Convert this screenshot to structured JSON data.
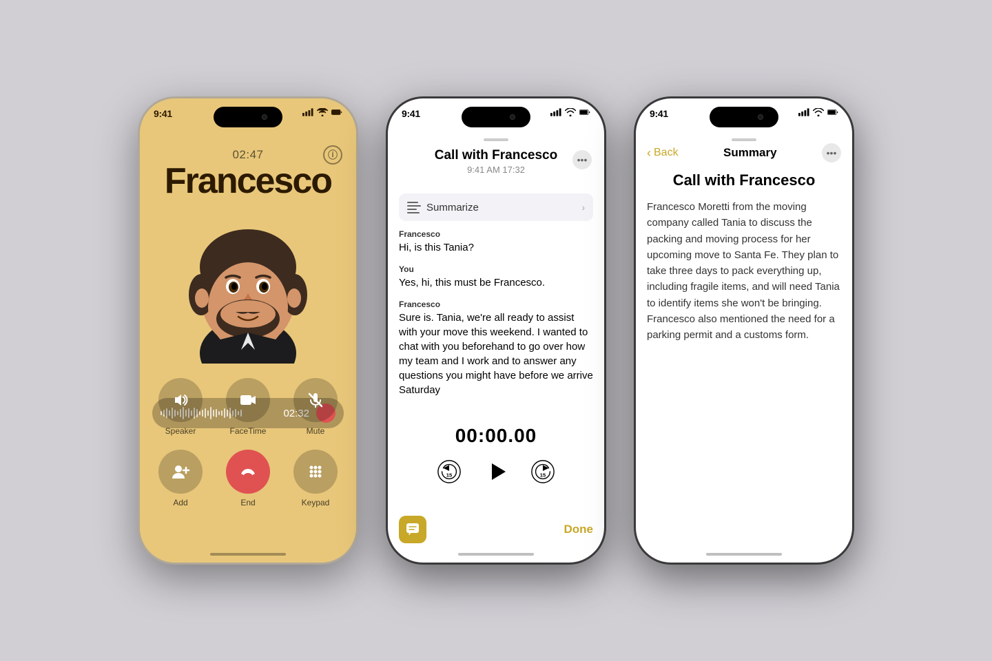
{
  "bg_color": "#d1cfd4",
  "phone1": {
    "status_time": "9:41",
    "call_duration": "02:47",
    "caller_name": "Francesco",
    "waveform_time": "02:32",
    "buttons": [
      {
        "id": "speaker",
        "label": "Speaker",
        "icon": "🔊"
      },
      {
        "id": "facetime",
        "label": "FaceTime",
        "icon": "📷"
      },
      {
        "id": "mute",
        "label": "Mute",
        "icon": "🎤"
      },
      {
        "id": "add",
        "label": "Add",
        "icon": "👤"
      },
      {
        "id": "end",
        "label": "End",
        "icon": "📞"
      },
      {
        "id": "keypad",
        "label": "Keypad",
        "icon": "⌨️"
      }
    ]
  },
  "phone2": {
    "status_time": "9:41",
    "title": "Call with Francesco",
    "subtitle": "9:41 AM  17:32",
    "summarize_label": "Summarize",
    "timer_display": "00:00.00",
    "done_label": "Done",
    "transcript": [
      {
        "speaker": "Francesco",
        "text": "Hi, is this Tania?"
      },
      {
        "speaker": "You",
        "text": "Yes, hi, this must be Francesco."
      },
      {
        "speaker": "Francesco",
        "text": "Sure is. Tania, we're all ready to assist with your move this weekend. I wanted to chat with you beforehand to go over how my team and I work and to answer any questions you might have before we arrive Saturday"
      }
    ]
  },
  "phone3": {
    "status_time": "9:41",
    "nav_back_label": "Back",
    "nav_title": "Summary",
    "title": "Call with Francesco",
    "body": "Francesco Moretti from the moving company called Tania to discuss the packing and moving process for her upcoming move to Santa Fe. They plan to take three days to pack everything up, including fragile items, and will need Tania to identify items she won't be bringing. Francesco also mentioned the need for a parking permit and a customs form."
  },
  "icons": {
    "signal": "signal-icon",
    "wifi": "wifi-icon",
    "battery": "battery-icon"
  }
}
